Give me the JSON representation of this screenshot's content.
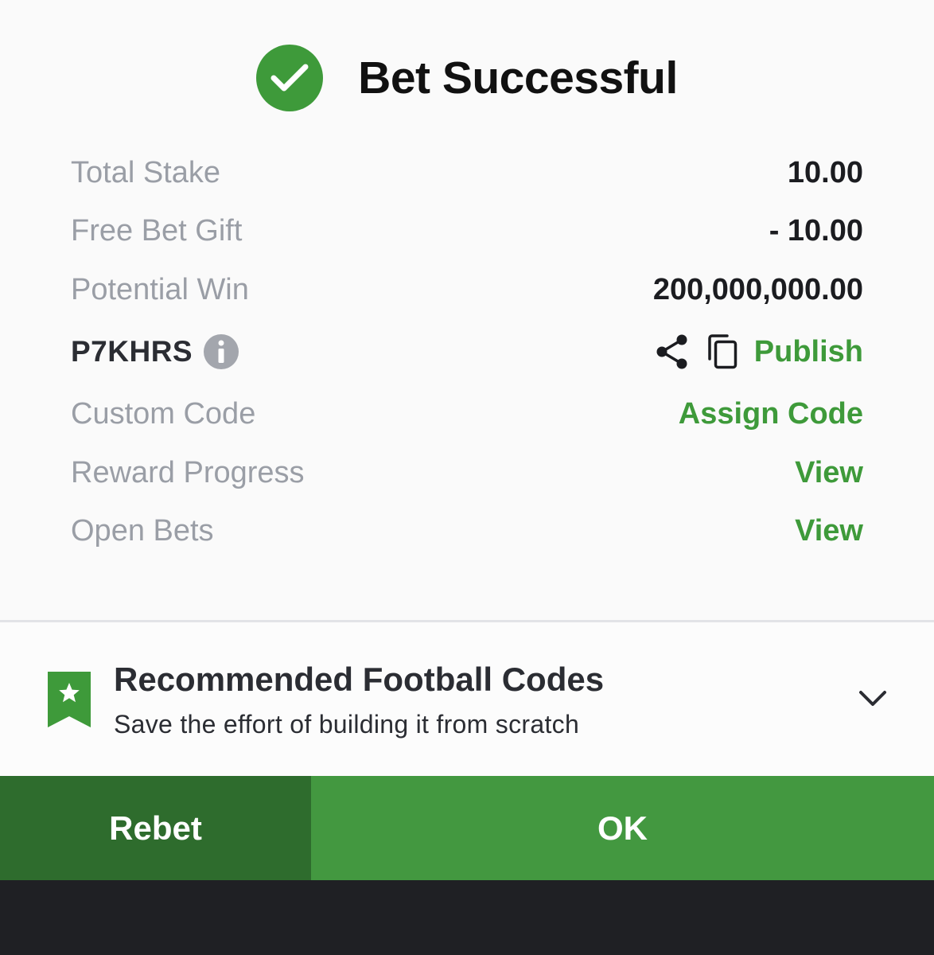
{
  "header": {
    "title": "Bet Successful",
    "icon": "check-circle-icon",
    "accent": "#3e9a3a"
  },
  "summary": {
    "total_stake_label": "Total Stake",
    "total_stake_value": "10.00",
    "free_bet_label": "Free Bet Gift",
    "free_bet_value": "- 10.00",
    "potential_win_label": "Potential Win",
    "potential_win_value": "200,000,000.00"
  },
  "booking": {
    "code": "P7KHRS",
    "publish_label": "Publish"
  },
  "links": {
    "custom_code_label": "Custom Code",
    "custom_code_action": "Assign Code",
    "reward_progress_label": "Reward Progress",
    "reward_progress_action": "View",
    "open_bets_label": "Open Bets",
    "open_bets_action": "View"
  },
  "recommended": {
    "title": "Recommended Football Codes",
    "subtitle": "Save the effort of building it from scratch"
  },
  "actions": {
    "rebet_label": "Rebet",
    "ok_label": "OK"
  },
  "colors": {
    "rebet_bg": "#2e6c2d",
    "ok_bg": "#439840",
    "bottom_bar": "#1f2024"
  }
}
